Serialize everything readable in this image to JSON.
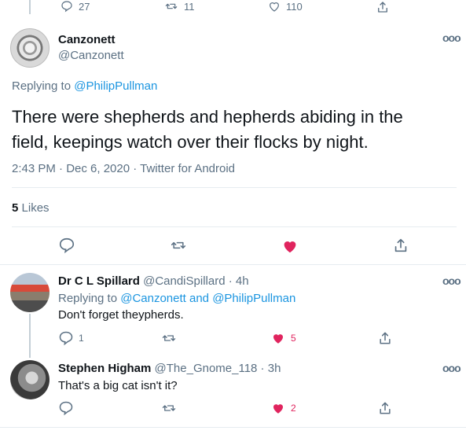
{
  "top_actions": {
    "reply_count": "27",
    "retweet_count": "11",
    "like_count": "110"
  },
  "main_tweet": {
    "display_name": "Canzonett",
    "handle": "@Canzonett",
    "replying_label": "Replying to",
    "replying_to": "@PhilipPullman",
    "text_line1": "There were shepherds and hepherds abiding in the",
    "text_line2": "field, keepings watch over their flocks by night.",
    "timestamp": "2:43 PM · Dec 6, 2020 · Twitter for Android",
    "likes_count": "5",
    "likes_label": "Likes"
  },
  "replies": [
    {
      "display_name": "Dr C L Spillard",
      "handle_time": "@CandiSpillard · 4h",
      "replying_label": "Replying to",
      "replying_to_1": "@Canzonett",
      "replying_and": "and",
      "replying_to_2": "@PhilipPullman",
      "text": "Don't forget theypherds.",
      "reply_count": "1",
      "like_count": "5"
    },
    {
      "display_name": "Stephen Higham",
      "handle_time": "@The_Gnome_118 · 3h",
      "text": "That's a big cat isn't it?",
      "like_count": "2"
    }
  ],
  "more_glyph": "ooo",
  "colors": {
    "like_red": "#e0245e",
    "link_blue": "#1b95e0",
    "muted": "#5b7083",
    "divider": "#e6ecf0"
  },
  "icons": [
    "reply-icon",
    "retweet-icon",
    "heart-icon",
    "share-icon",
    "more-icon"
  ]
}
